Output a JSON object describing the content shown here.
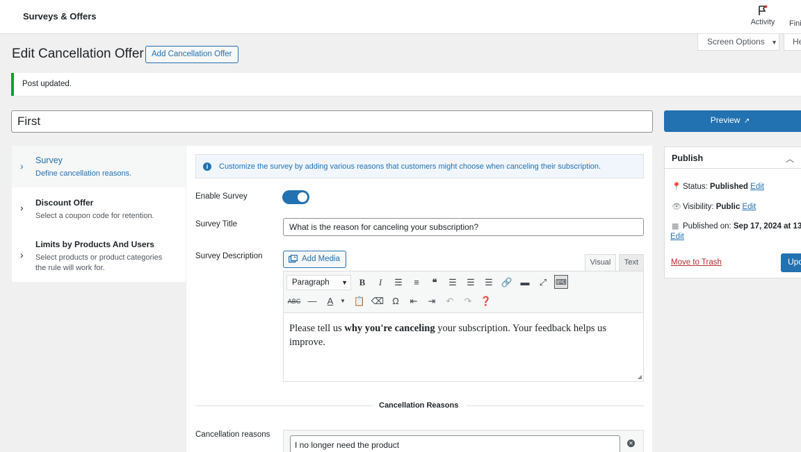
{
  "topbar": {
    "brand": "Surveys & Offers",
    "activity_label": "Activity",
    "finish_label": "Fini"
  },
  "screen_options": "Screen Options",
  "help_tab": "He",
  "page": {
    "title": "Edit Cancellation Offer",
    "add_button": "Add Cancellation Offer"
  },
  "notice": "Post updated.",
  "post_title": "First",
  "preview_button": "Preview",
  "nav": [
    {
      "title": "Survey",
      "desc": "Define cancellation reasons."
    },
    {
      "title": "Discount Offer",
      "desc": "Select a coupon code for retention."
    },
    {
      "title": "Limits by Products And Users",
      "desc": "Select products or product categories the rule will work for."
    }
  ],
  "info": "Customize the survey by adding various reasons that customers might choose when canceling their subscription.",
  "fields": {
    "enable_survey": "Enable Survey",
    "survey_title_label": "Survey Title",
    "survey_title_value": "What is the reason for canceling your subscription?",
    "survey_desc_label": "Survey Description",
    "add_media": "Add Media",
    "tab_visual": "Visual",
    "tab_text": "Text",
    "format_select": "Paragraph",
    "content_before": "Please tell us ",
    "content_bold": "why you're canceling",
    "content_after": " your subscription. Your feedback helps us improve."
  },
  "reasons": {
    "section_title": "Cancellation Reasons",
    "label": "Cancellation reasons",
    "first_value": "I no longer need the product"
  },
  "publish": {
    "title": "Publish",
    "status_label": "Status: ",
    "status_value": "Published",
    "visibility_label": "Visibility: ",
    "visibility_value": "Public",
    "published_label": "Published on: ",
    "published_value": "Sep 17, 2024 at 13",
    "edit": "Edit",
    "trash": "Move to Trash",
    "update": "Upd"
  },
  "colors": {
    "accent": "#2271b1",
    "success": "#00a32a",
    "danger": "#b32d2e"
  }
}
